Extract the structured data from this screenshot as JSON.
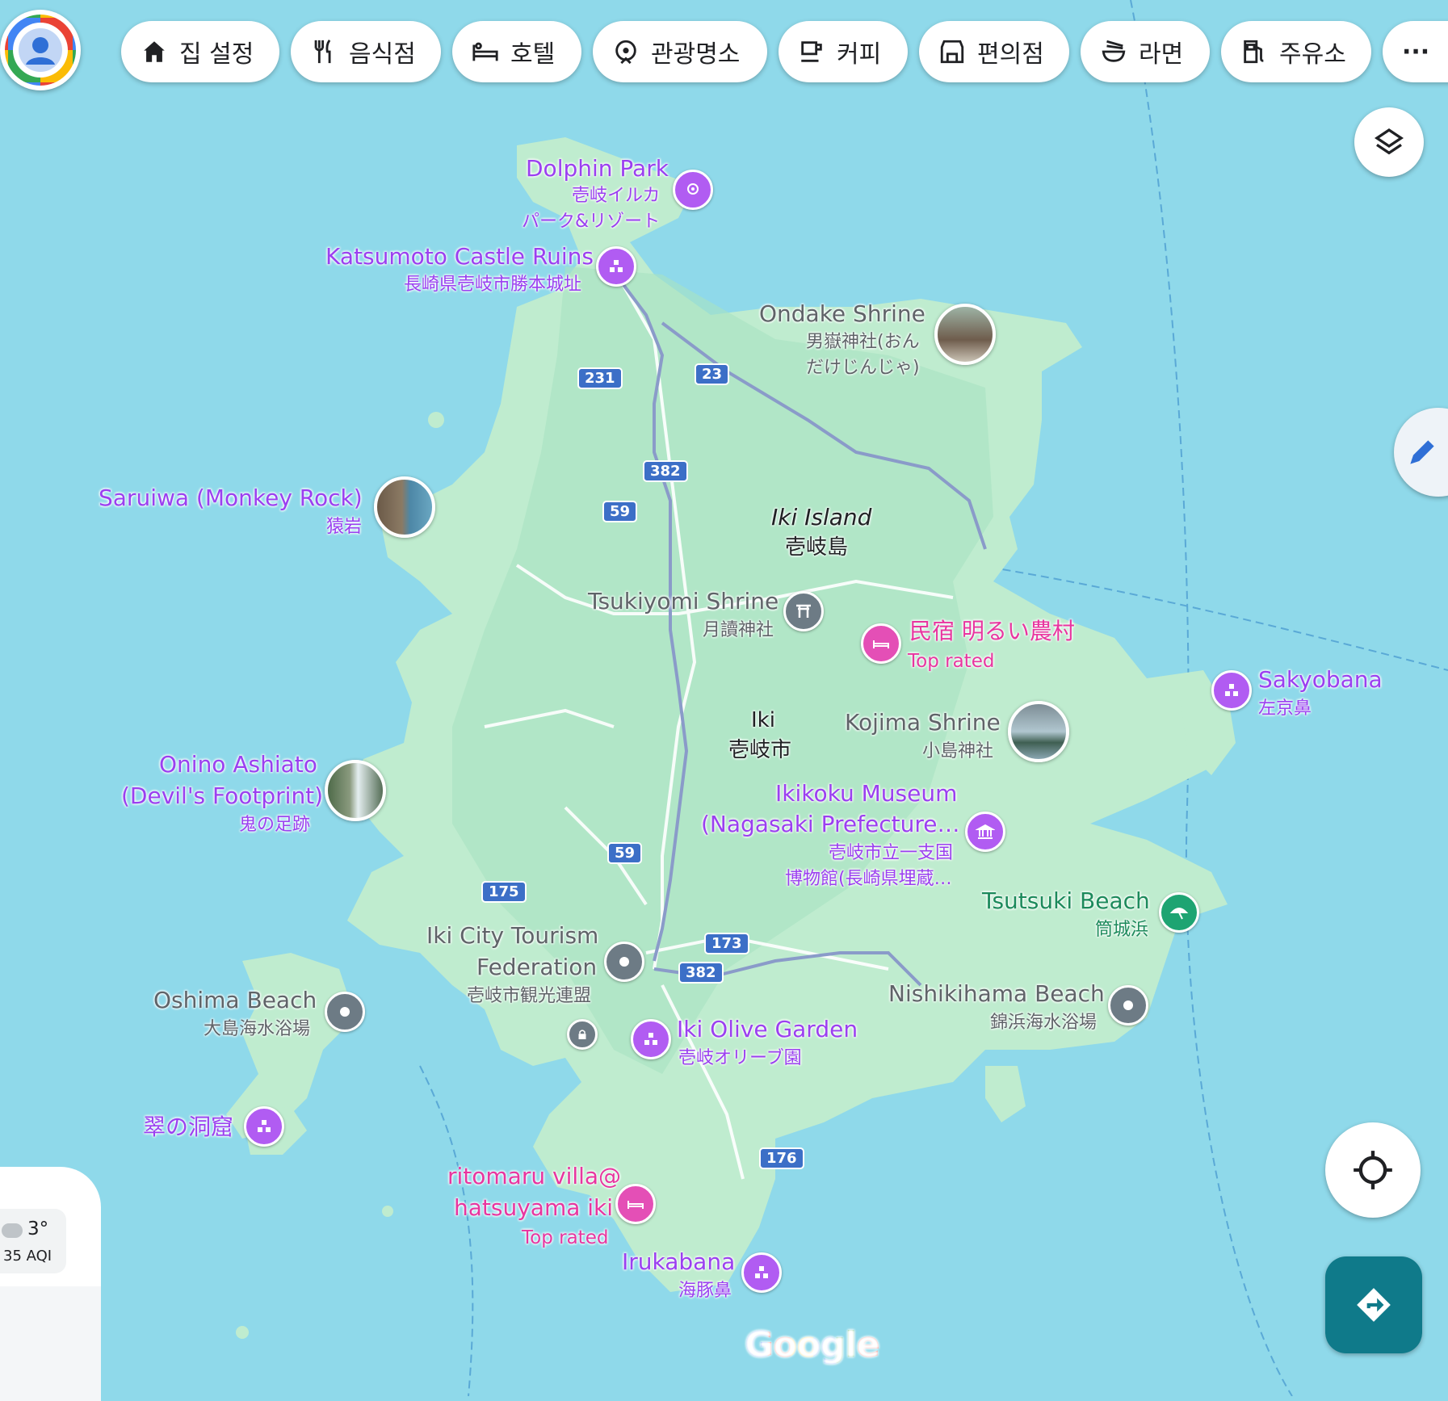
{
  "chips": [
    {
      "label": "집 설정",
      "icon": "home-icon"
    },
    {
      "label": "음식점",
      "icon": "restaurant-icon"
    },
    {
      "label": "호텔",
      "icon": "hotel-icon"
    },
    {
      "label": "관광명소",
      "icon": "attraction-icon"
    },
    {
      "label": "커피",
      "icon": "coffee-icon"
    },
    {
      "label": "편의점",
      "icon": "convenience-store-icon"
    },
    {
      "label": "라면",
      "icon": "ramen-icon"
    },
    {
      "label": "주유소",
      "icon": "gas-station-icon"
    }
  ],
  "more_label": "···",
  "island": {
    "name_en": "Iki Island",
    "name_ja": "壱岐島"
  },
  "city": {
    "name_en": "Iki",
    "name_ja": "壱岐市"
  },
  "places": {
    "dolphin": {
      "name": "Dolphin Park",
      "sub1": "壱岐イルカ",
      "sub2": "パーク&リゾート"
    },
    "katsumoto": {
      "name": "Katsumoto Castle Ruins",
      "sub": "長崎県壱岐市勝本城址"
    },
    "ondake": {
      "name": "Ondake Shrine",
      "sub1": "男嶽神社(おん",
      "sub2": "だけじんじゃ)"
    },
    "saruiwa": {
      "name": "Saruiwa (Monkey Rock)",
      "sub": "猿岩"
    },
    "tsukiyomi": {
      "name": "Tsukiyomi Shrine",
      "sub": "月讀神社"
    },
    "minshuku": {
      "name": "民宿 明るい農村",
      "sub": "Top rated"
    },
    "sakyobana": {
      "name": "Sakyobana",
      "sub": "左京鼻"
    },
    "kojima": {
      "name": "Kojima Shrine",
      "sub": "小島神社"
    },
    "onino": {
      "name1": "Onino Ashiato",
      "name2": "(Devil's Footprint)",
      "sub": "鬼の足跡"
    },
    "ikikoku": {
      "name1": "Ikikoku Museum",
      "name2": "(Nagasaki Prefecture…",
      "sub1": "壱岐市立一支国",
      "sub2": "博物館(長崎県埋蔵…"
    },
    "tsutsuki": {
      "name": "Tsutsuki Beach",
      "sub": "筒城浜"
    },
    "tourism": {
      "name1": "Iki City Tourism",
      "name2": "Federation",
      "sub": "壱岐市観光連盟"
    },
    "oshima": {
      "name": "Oshima Beach",
      "sub": "大島海水浴場"
    },
    "nishikihama": {
      "name": "Nishikihama Beach",
      "sub": "錦浜海水浴場"
    },
    "olive": {
      "name": "Iki Olive Garden",
      "sub": "壱岐オリーブ園"
    },
    "midori": {
      "name": "翠の洞窟"
    },
    "ritomaru": {
      "name1": "ritomaru villa@",
      "name2": "hatsuyama iki",
      "sub": "Top rated"
    },
    "irukabana": {
      "name": "Irukabana",
      "sub": "海豚鼻"
    }
  },
  "routes": [
    "231",
    "23",
    "382",
    "59",
    "59",
    "175",
    "173",
    "382",
    "176"
  ],
  "weather": {
    "temp": "3°",
    "aqi": "35 AQI"
  },
  "logo": "Google"
}
